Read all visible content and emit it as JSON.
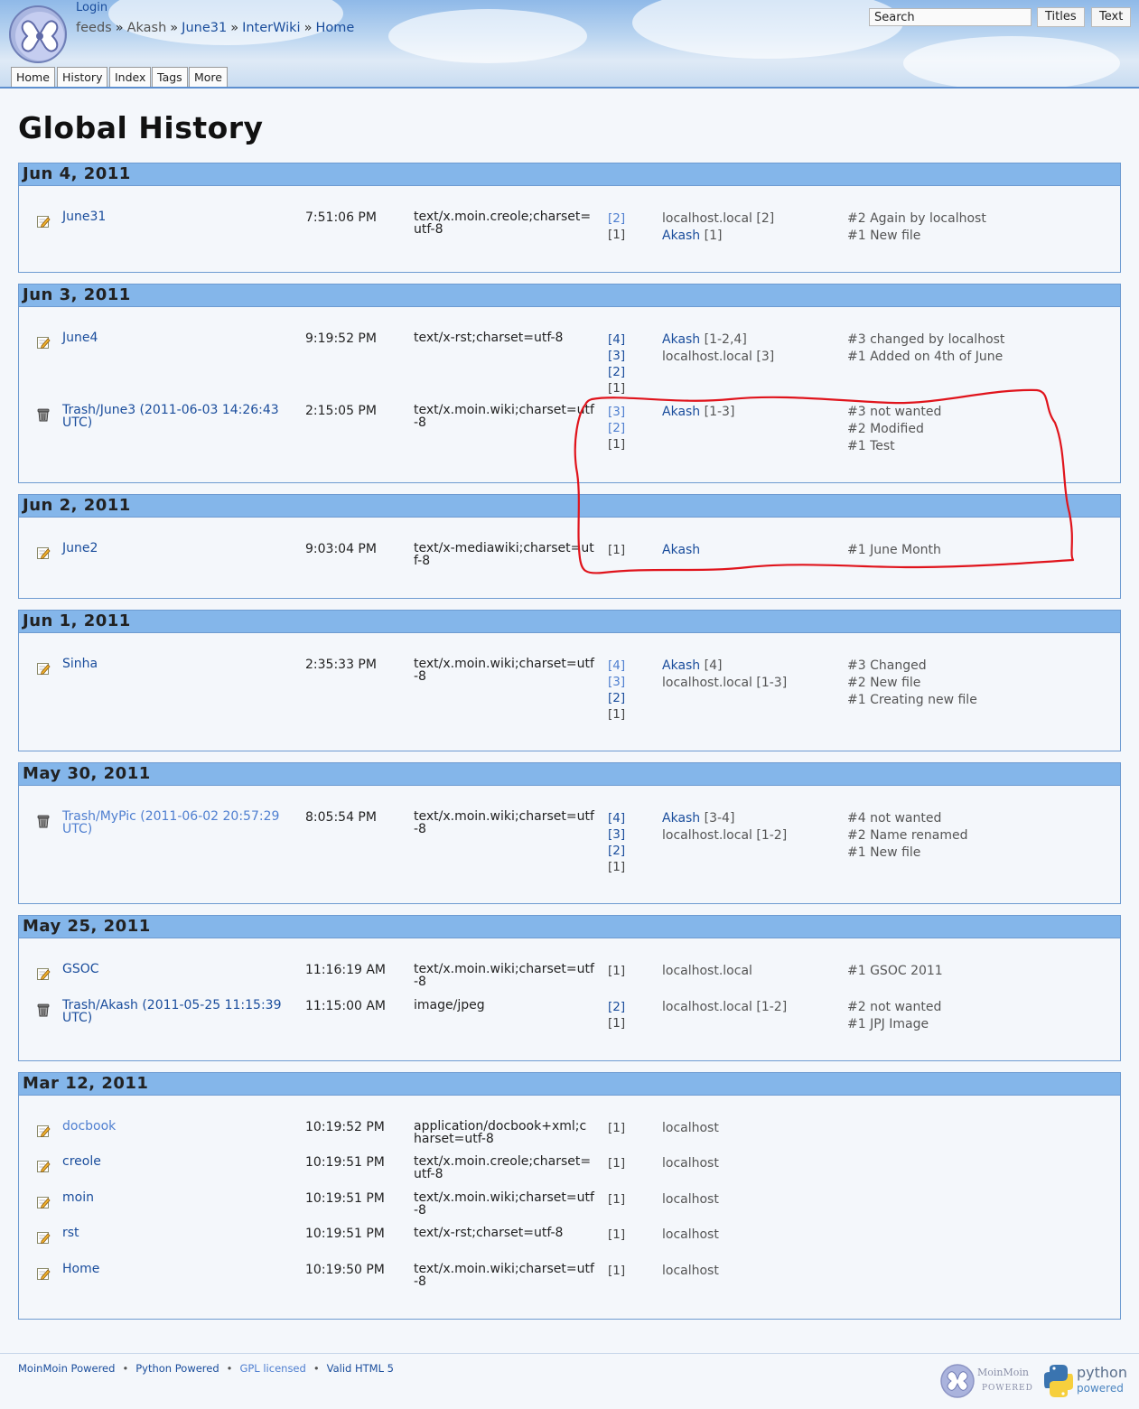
{
  "header": {
    "login_label": "Login",
    "breadcrumbs": [
      {
        "label": "feeds",
        "link": false
      },
      {
        "label": "Akash",
        "link": false
      },
      {
        "label": "June31",
        "link": true
      },
      {
        "label": "InterWiki",
        "link": true
      },
      {
        "label": "Home",
        "link": true
      }
    ],
    "breadcrumb_sep": "»",
    "search": {
      "value": "Search",
      "titles_label": "Titles",
      "text_label": "Text"
    },
    "tabs": [
      "Home",
      "History",
      "Index",
      "Tags",
      "More"
    ]
  },
  "page": {
    "title": "Global History"
  },
  "days": [
    {
      "date": "Jun 4, 2011",
      "rows": [
        {
          "icon": "edit-icon",
          "name": "June31",
          "name_style": "dark",
          "time": "7:51:06 PM",
          "ctype": "text/x.moin.creole;charset=utf-8",
          "revs": [
            {
              "t": "[2]",
              "s": "light"
            },
            {
              "t": "[1]",
              "s": "plain"
            }
          ],
          "editors": [
            {
              "name": "localhost.local",
              "link": false,
              "range": "[2]"
            },
            {
              "name": "Akash",
              "link": true,
              "range": "[1]"
            }
          ],
          "comments": [
            "#2 Again by localhost",
            "#1 New file"
          ]
        }
      ]
    },
    {
      "date": "Jun 3, 2011",
      "rows": [
        {
          "icon": "edit-icon",
          "name": "June4",
          "name_style": "dark",
          "time": "9:19:52 PM",
          "ctype": "text/x-rst;charset=utf-8",
          "revs": [
            {
              "t": "[4]",
              "s": "dark"
            },
            {
              "t": "[3]",
              "s": "dark"
            },
            {
              "t": "[2]",
              "s": "dark"
            },
            {
              "t": "[1]",
              "s": "plain"
            }
          ],
          "editors": [
            {
              "name": "Akash",
              "link": true,
              "range": "[1-2,4]"
            },
            {
              "name": "localhost.local",
              "link": false,
              "range": "[3]"
            }
          ],
          "comments": [
            "#3 changed by localhost",
            "#1 Added on 4th of June"
          ]
        },
        {
          "icon": "trash-icon",
          "name": "Trash/June3 (2011-06-03 14:26:43 UTC)",
          "name_style": "dark",
          "time": "2:15:05 PM",
          "ctype": "text/x.moin.wiki;charset=utf-8",
          "revs": [
            {
              "t": "[3]",
              "s": "light"
            },
            {
              "t": "[2]",
              "s": "light"
            },
            {
              "t": "[1]",
              "s": "plain"
            }
          ],
          "editors": [
            {
              "name": "Akash",
              "link": true,
              "range": "[1-3]"
            }
          ],
          "comments": [
            "#3 not wanted",
            "#2 Modified",
            "#1 Test"
          ]
        }
      ]
    },
    {
      "date": "Jun 2, 2011",
      "rows": [
        {
          "icon": "edit-icon",
          "name": "June2",
          "name_style": "dark",
          "time": "9:03:04 PM",
          "ctype": "text/x-mediawiki;charset=utf-8",
          "revs": [
            {
              "t": "[1]",
              "s": "plain"
            }
          ],
          "editors": [
            {
              "name": "Akash",
              "link": true,
              "range": ""
            }
          ],
          "comments": [
            "#1 June Month"
          ]
        }
      ]
    },
    {
      "date": "Jun 1, 2011",
      "rows": [
        {
          "icon": "edit-icon",
          "name": "Sinha",
          "name_style": "dark",
          "time": "2:35:33 PM",
          "ctype": "text/x.moin.wiki;charset=utf-8",
          "revs": [
            {
              "t": "[4]",
              "s": "light"
            },
            {
              "t": "[3]",
              "s": "light"
            },
            {
              "t": "[2]",
              "s": "dark"
            },
            {
              "t": "[1]",
              "s": "plain"
            }
          ],
          "editors": [
            {
              "name": "Akash",
              "link": true,
              "range": "[4]"
            },
            {
              "name": "localhost.local",
              "link": false,
              "range": "[1-3]"
            }
          ],
          "comments": [
            "#3 Changed",
            "#2 New file",
            "#1 Creating new file"
          ]
        }
      ]
    },
    {
      "date": "May 30, 2011",
      "rows": [
        {
          "icon": "trash-icon",
          "name": "Trash/MyPic (2011-06-02 20:57:29 UTC)",
          "name_style": "light",
          "time": "8:05:54 PM",
          "ctype": "text/x.moin.wiki;charset=utf-8",
          "revs": [
            {
              "t": "[4]",
              "s": "dark"
            },
            {
              "t": "[3]",
              "s": "dark"
            },
            {
              "t": "[2]",
              "s": "dark"
            },
            {
              "t": "[1]",
              "s": "plain"
            }
          ],
          "editors": [
            {
              "name": "Akash",
              "link": true,
              "range": "[3-4]"
            },
            {
              "name": "localhost.local",
              "link": false,
              "range": "[1-2]"
            }
          ],
          "comments": [
            "#4 not wanted",
            "#2 Name renamed",
            "#1 New file"
          ]
        }
      ]
    },
    {
      "date": "May 25, 2011",
      "rows": [
        {
          "icon": "edit-icon",
          "name": "GSOC",
          "name_style": "dark",
          "time": "11:16:19 AM",
          "ctype": "text/x.moin.wiki;charset=utf-8",
          "revs": [
            {
              "t": "[1]",
              "s": "plain"
            }
          ],
          "editors": [
            {
              "name": "localhost.local",
              "link": false,
              "range": ""
            }
          ],
          "comments": [
            "#1 GSOC 2011"
          ]
        },
        {
          "icon": "trash-icon",
          "name": "Trash/Akash (2011-05-25 11:15:39 UTC)",
          "name_style": "dark",
          "time": "11:15:00 AM",
          "ctype": "image/jpeg",
          "revs": [
            {
              "t": "[2]",
              "s": "dark"
            },
            {
              "t": "[1]",
              "s": "plain"
            }
          ],
          "editors": [
            {
              "name": "localhost.local",
              "link": false,
              "range": "[1-2]"
            }
          ],
          "comments": [
            "#2 not wanted",
            "#1 JPJ Image"
          ]
        }
      ]
    },
    {
      "date": "Mar 12, 2011",
      "rows": [
        {
          "icon": "edit-icon",
          "name": "docbook",
          "name_style": "light",
          "time": "10:19:52 PM",
          "ctype": "application/docbook+xml;charset=utf-8",
          "revs": [
            {
              "t": "[1]",
              "s": "plain"
            }
          ],
          "editors": [
            {
              "name": "localhost",
              "link": false,
              "range": ""
            }
          ],
          "comments": []
        },
        {
          "icon": "edit-icon",
          "name": "creole",
          "name_style": "dark",
          "time": "10:19:51 PM",
          "ctype": "text/x.moin.creole;charset=utf-8",
          "revs": [
            {
              "t": "[1]",
              "s": "plain"
            }
          ],
          "editors": [
            {
              "name": "localhost",
              "link": false,
              "range": ""
            }
          ],
          "comments": []
        },
        {
          "icon": "edit-icon",
          "name": "moin",
          "name_style": "dark",
          "time": "10:19:51 PM",
          "ctype": "text/x.moin.wiki;charset=utf-8",
          "revs": [
            {
              "t": "[1]",
              "s": "plain"
            }
          ],
          "editors": [
            {
              "name": "localhost",
              "link": false,
              "range": ""
            }
          ],
          "comments": []
        },
        {
          "icon": "edit-icon",
          "name": "rst",
          "name_style": "dark",
          "time": "10:19:51 PM",
          "ctype": "text/x-rst;charset=utf-8",
          "revs": [
            {
              "t": "[1]",
              "s": "plain"
            }
          ],
          "editors": [
            {
              "name": "localhost",
              "link": false,
              "range": ""
            }
          ],
          "comments": []
        },
        {
          "icon": "edit-icon",
          "name": "Home",
          "name_style": "dark",
          "time": "10:19:50 PM",
          "ctype": "text/x.moin.wiki;charset=utf-8",
          "revs": [
            {
              "t": "[1]",
              "s": "plain"
            }
          ],
          "editors": [
            {
              "name": "localhost",
              "link": false,
              "range": ""
            }
          ],
          "comments": []
        }
      ]
    }
  ],
  "footer": {
    "links": [
      {
        "label": "MoinMoin Powered",
        "style": "dark"
      },
      {
        "label": "Python Powered",
        "style": "dark"
      },
      {
        "label": "GPL licensed",
        "style": "light"
      },
      {
        "label": "Valid HTML 5",
        "style": "dark"
      }
    ],
    "sep": "•",
    "moin_badge": {
      "line1": "MoinMoin",
      "line2": "POWERED"
    },
    "python_badge": {
      "line1": "python",
      "line2": "powered"
    }
  },
  "colors": {
    "link": "#1a4d9c",
    "link_light": "#4f7fd0",
    "day_header": "#84b6ea",
    "annotation": "#e0141c"
  }
}
